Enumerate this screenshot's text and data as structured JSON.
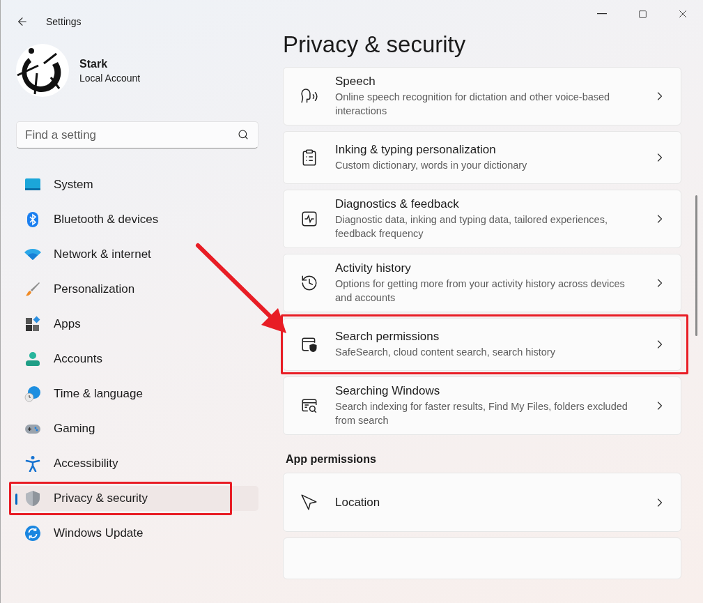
{
  "window": {
    "title": "Settings"
  },
  "account": {
    "name": "Stark",
    "type": "Local Account"
  },
  "search": {
    "placeholder": "Find a setting"
  },
  "nav": [
    {
      "kind": "system",
      "label": "System",
      "selected": false,
      "highlighted": false
    },
    {
      "kind": "bluetooth",
      "label": "Bluetooth & devices",
      "selected": false,
      "highlighted": false
    },
    {
      "kind": "network",
      "label": "Network & internet",
      "selected": false,
      "highlighted": false
    },
    {
      "kind": "personalization",
      "label": "Personalization",
      "selected": false,
      "highlighted": false
    },
    {
      "kind": "apps",
      "label": "Apps",
      "selected": false,
      "highlighted": false
    },
    {
      "kind": "accounts",
      "label": "Accounts",
      "selected": false,
      "highlighted": false
    },
    {
      "kind": "time",
      "label": "Time & language",
      "selected": false,
      "highlighted": false
    },
    {
      "kind": "gaming",
      "label": "Gaming",
      "selected": false,
      "highlighted": false
    },
    {
      "kind": "accessibility",
      "label": "Accessibility",
      "selected": false,
      "highlighted": false
    },
    {
      "kind": "privacy",
      "label": "Privacy & security",
      "selected": true,
      "highlighted": true
    },
    {
      "kind": "update",
      "label": "Windows Update",
      "selected": false,
      "highlighted": false
    }
  ],
  "page_title": "Privacy & security",
  "settings": [
    {
      "kind": "speech",
      "title": "Speech",
      "description": "Online speech recognition for dictation and other voice-based interactions",
      "highlighted": false
    },
    {
      "kind": "inking",
      "title": "Inking & typing personalization",
      "description": "Custom dictionary, words in your dictionary",
      "highlighted": false
    },
    {
      "kind": "diagnostics",
      "title": "Diagnostics & feedback",
      "description": "Diagnostic data, inking and typing data, tailored experiences, feedback frequency",
      "highlighted": false
    },
    {
      "kind": "activity",
      "title": "Activity history",
      "description": "Options for getting more from your activity history across devices and accounts",
      "highlighted": false
    },
    {
      "kind": "search-permissions",
      "title": "Search permissions",
      "description": "SafeSearch, cloud content search, search history",
      "highlighted": true
    },
    {
      "kind": "searching",
      "title": "Searching Windows",
      "description": "Search indexing for faster results, Find My Files, folders excluded from search",
      "highlighted": false
    }
  ],
  "app_permissions": {
    "heading": "App permissions",
    "items": [
      {
        "kind": "location",
        "title": "Location",
        "highlighted": false
      }
    ]
  },
  "callout_arrow": true
}
